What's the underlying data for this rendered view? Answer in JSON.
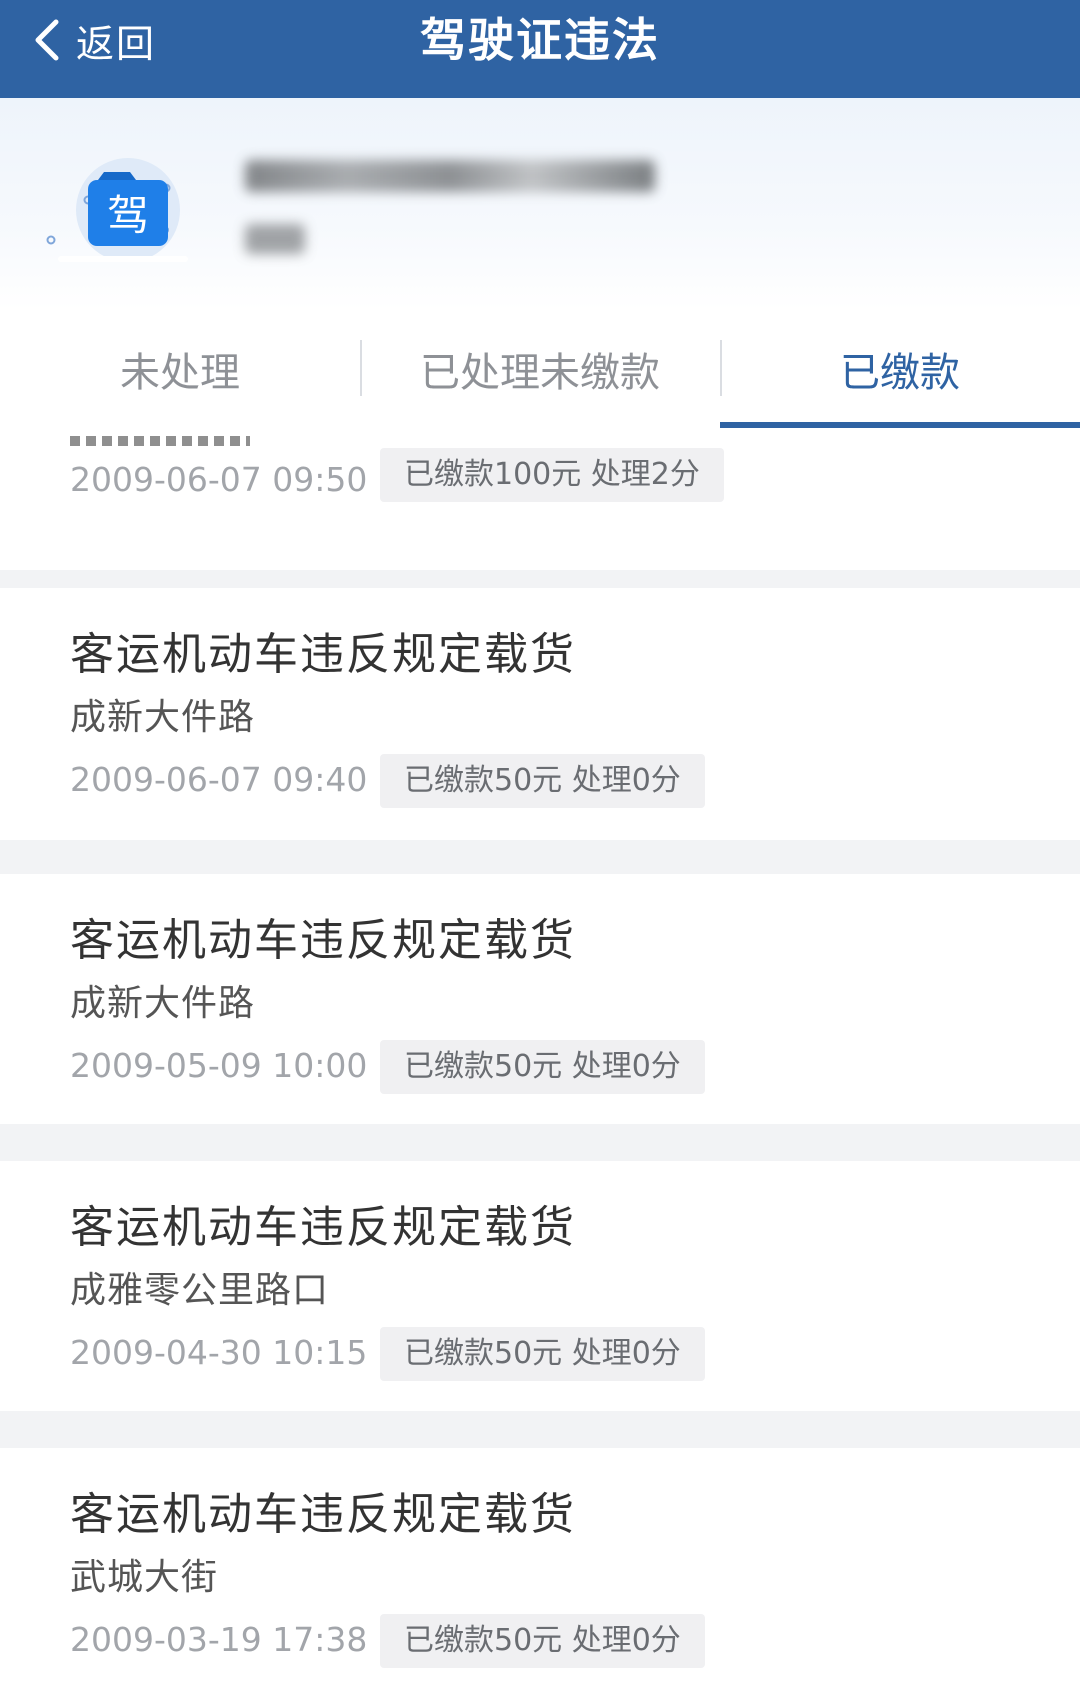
{
  "header": {
    "back_label": "返回",
    "title": "驾驶证违法"
  },
  "licence": {
    "icon_char": "驾"
  },
  "tabs": [
    {
      "label": "未处理",
      "active": false
    },
    {
      "label": "已处理未缴款",
      "active": false
    },
    {
      "label": "已缴款",
      "active": true
    }
  ],
  "records": [
    {
      "title": "",
      "location": "",
      "time": "2009-06-07 09:50",
      "status": "已缴款100元 处理2分",
      "partial": true
    },
    {
      "title": "客运机动车违反规定载货",
      "location": "成新大件路",
      "time": "2009-06-07 09:40",
      "status": "已缴款50元 处理0分"
    },
    {
      "title": "客运机动车违反规定载货",
      "location": "成新大件路",
      "time": "2009-05-09 10:00",
      "status": "已缴款50元 处理0分"
    },
    {
      "title": "客运机动车违反规定载货",
      "location": "成雅零公里路口",
      "time": "2009-04-30 10:15",
      "status": "已缴款50元 处理0分"
    },
    {
      "title": "客运机动车违反规定载货",
      "location": "武城大街",
      "time": "2009-03-19 17:38",
      "status": "已缴款50元 处理0分"
    }
  ],
  "colors": {
    "primary": "#2f63a3",
    "icon_blue": "#2b8ef5",
    "background": "#f2f3f5"
  }
}
